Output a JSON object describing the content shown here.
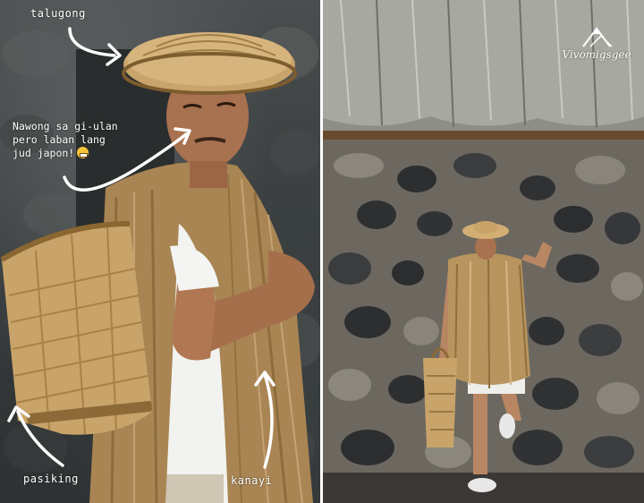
{
  "labels": {
    "hat": "talugong",
    "basket": "pasiking",
    "cape": "kanayi",
    "note_line1": "Nawong sa gi-ulan",
    "note_line2": "pero laban lang",
    "note_line3": "jud japon!"
  },
  "watermark": {
    "text": "Vivomigsgee",
    "icon": "mountain-logo-icon"
  },
  "colors": {
    "annotation": "#ffffff",
    "straw": "#b8955f",
    "hat": "#c9a46a",
    "stone_dark": "#2f3234",
    "stone_light": "#8a8578",
    "shirt": "#f4f4f2",
    "emoji": "#f5c53a"
  }
}
